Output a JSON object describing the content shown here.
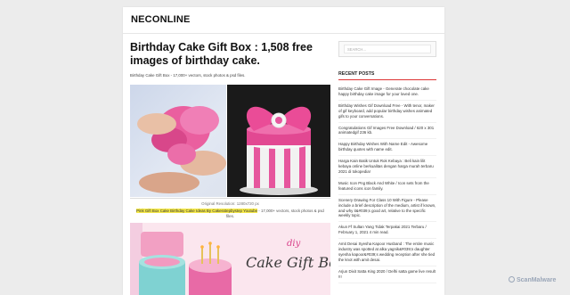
{
  "site": {
    "name": "NECONLINE"
  },
  "post": {
    "title": "Birthday Cake Gift Box : 1,508 free images of birthday cake.",
    "intro": "Birthday Cake Gift Box - 17,000+ vectors, stock photos & psd files.",
    "image1": {
      "caption": "Original Resolution: 1280x720 px"
    },
    "image1_source": {
      "link_text": "Pink Gift Box Cake Birthday Cake Ideas By Cakesstepbystep Youtube",
      "rest": " - 17,000+ vectors, stock photos & psd files."
    },
    "image2": {
      "text_diy": "diy",
      "text_title": "Cake Gift Box"
    }
  },
  "sidebar": {
    "search_placeholder": "SEARCH...",
    "recent_title": "RECENT POSTS",
    "recent_posts": [
      "Birthday Cake Gift Image - Generate chocolate cake happy birthday cake image for your loved one.",
      "Birthday Wishes Gif Download Free - With tenor, maker of gif keyboard, add popular birthday wishes animated gifs to your conversations.",
      "Congratulations Gif Images Free Download / 620 x 301 animatedgif 236 kb.",
      "Happy Birthday Wishes With Name Edit - Awesome birthday quotes with name edit.",
      "Harga Kain Batik Untuk Rok Kebaya : Beli kain lilit kebaya online berkualitas dengan harga murah terbaru 2021 di tokopedia!",
      "Music Icon Png Black And White / Icon sets from the featured icons icon family.",
      "Scenery Drawing For Class 10 With Figure - Please include a brief description of the medium, artist if known, and why it&#039;s good art, relative to the specific weekly topic.",
      "Akun Ff Sultan Yang Tidak Terpakai 2021 Terbaru / February 1, 2021 4 min read.",
      "Amit Desai Syesha Kapoor Husband : The entire music industry was spotted at alka yagnik&#039;s daughter syesha kapoor&#039;s wedding reception after she tied the knot with amit desai.",
      "Arjun Dixit Satta King 2020 / Delhi satta game live result !!!"
    ]
  },
  "watermark": "ScanMalware"
}
